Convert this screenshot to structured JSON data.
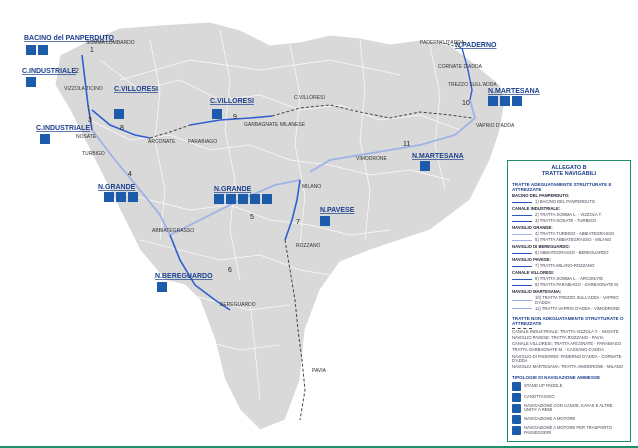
{
  "title": "ALLEGATO B",
  "subtitle": "TRATTE NAVIGABILI",
  "place_labels": [
    "BACINO del PANPERDUTO",
    "C.INDUSTRIALE",
    "C.INDUSTRIALE",
    "C.VILLORESI",
    "C.VILLORESI",
    "N.GRANDE",
    "N.GRANDE",
    "N.PAVESE",
    "N.BEREGUARDO",
    "N.MARTESANA",
    "N.MARTESANA",
    "N.PADERNO"
  ],
  "towns": [
    "SOMMA LOMBARDO",
    "VIZZOLA TICINO",
    "NOSATE",
    "TURBIGO",
    "ARCONATE",
    "PARABIAGO",
    "GARBAGNATE MILANESE",
    "C.VILLORESI",
    "VIMODRONE",
    "MILANO",
    "ABBIATEGRASSO",
    "ROZZANO",
    "BEREGUARDO",
    "PAVIA",
    "PADERNO D'ADDA",
    "CORNATE D'ADDA",
    "TREZZO SULL'ADDA",
    "VAPRIO D'ADDA"
  ],
  "route_numbers": [
    "1",
    "2",
    "3",
    "4",
    "5",
    "6",
    "7",
    "8",
    "9",
    "10",
    "11"
  ],
  "legend": {
    "title": "ALLEGATO B",
    "subtitle": "TRATTE NAVIGABILI",
    "section1": "TRATTE ADEGUATAMENTE STRUTTURATE E ATTREZZATE",
    "entries": [
      {
        "head": "BACINO DEL PANPERDUTO:",
        "lines": [
          "1) BACINO DEL PANPERDUTO"
        ]
      },
      {
        "head": "CANALE INDUSTRIALE:",
        "lines": [
          "2) TRATTA SOMMA L. - VIZZOLA T.",
          "3) TRATTA NOSATE - TURBIGO"
        ]
      },
      {
        "head": "NAVIGLIO GRANDE:",
        "lines": [
          "4) TRATTA TURBIGO - ABBIATEGRASSO",
          "5) TRATTA ABBIATEGRASSO - MILANO"
        ]
      },
      {
        "head": "NAVIGLIO DI BEREGUARDO:",
        "lines": [
          "6) ABBIATEGRASSO - BEREGUARDO"
        ]
      },
      {
        "head": "NAVIGLIO PAVESE:",
        "lines": [
          "7) TRATTA MILANO-ROZZANO"
        ]
      },
      {
        "head": "CANALE VILLORESI:",
        "lines": [
          "8) TRATTA SOMMA L. - ARCONATE",
          "9) TRATTA PARABIAGO - GARBAGNATE M."
        ]
      },
      {
        "head": "NAVIGLIO MARTESANA:",
        "lines": [
          "10) TRATTA TREZZO SULL'ADDA - VAPRIO D'ADDA",
          "11) TRATTA VAPRIO D'ADDA - VIMODRONE"
        ]
      }
    ],
    "section2": "TRATTE NON ADEGUATAMENTE STRUTTURATE O ATTREZZATE",
    "entries2": [
      "CANALE INDUSTRIALE: TRATTA VIZZOLA T. - NOSATE",
      "NAVIGLIO PAVESE: TRATTA ROZZANO - PAVIA",
      "CANALE VILLORESI: TRATTA ARCONATE - PARABIAGO",
      "TRATTA GARBAGNATE M. - CASSANO D'ADDA",
      "NAVIGLIO DI PADERNO: PADERNO D'ADDA - CORNATE D'ADDA",
      "NAVIGLIO MARTESANA: TRATTA VIMODRONE - MILANO"
    ],
    "section3": "TIPOLOGIE DI NAVIGAZIONE AMMESSE",
    "types": [
      "STAND UP PADDLE",
      "CANOTTAGGIO",
      "NAVIGAZIONE CON CANOE, KAYAK E ALTRE UNITA' A REMI",
      "NAVIGAZIONE A MOTORE",
      "NAVIGAZIONE A MOTORE PER TRASPORTO PASSEGGERI"
    ]
  }
}
